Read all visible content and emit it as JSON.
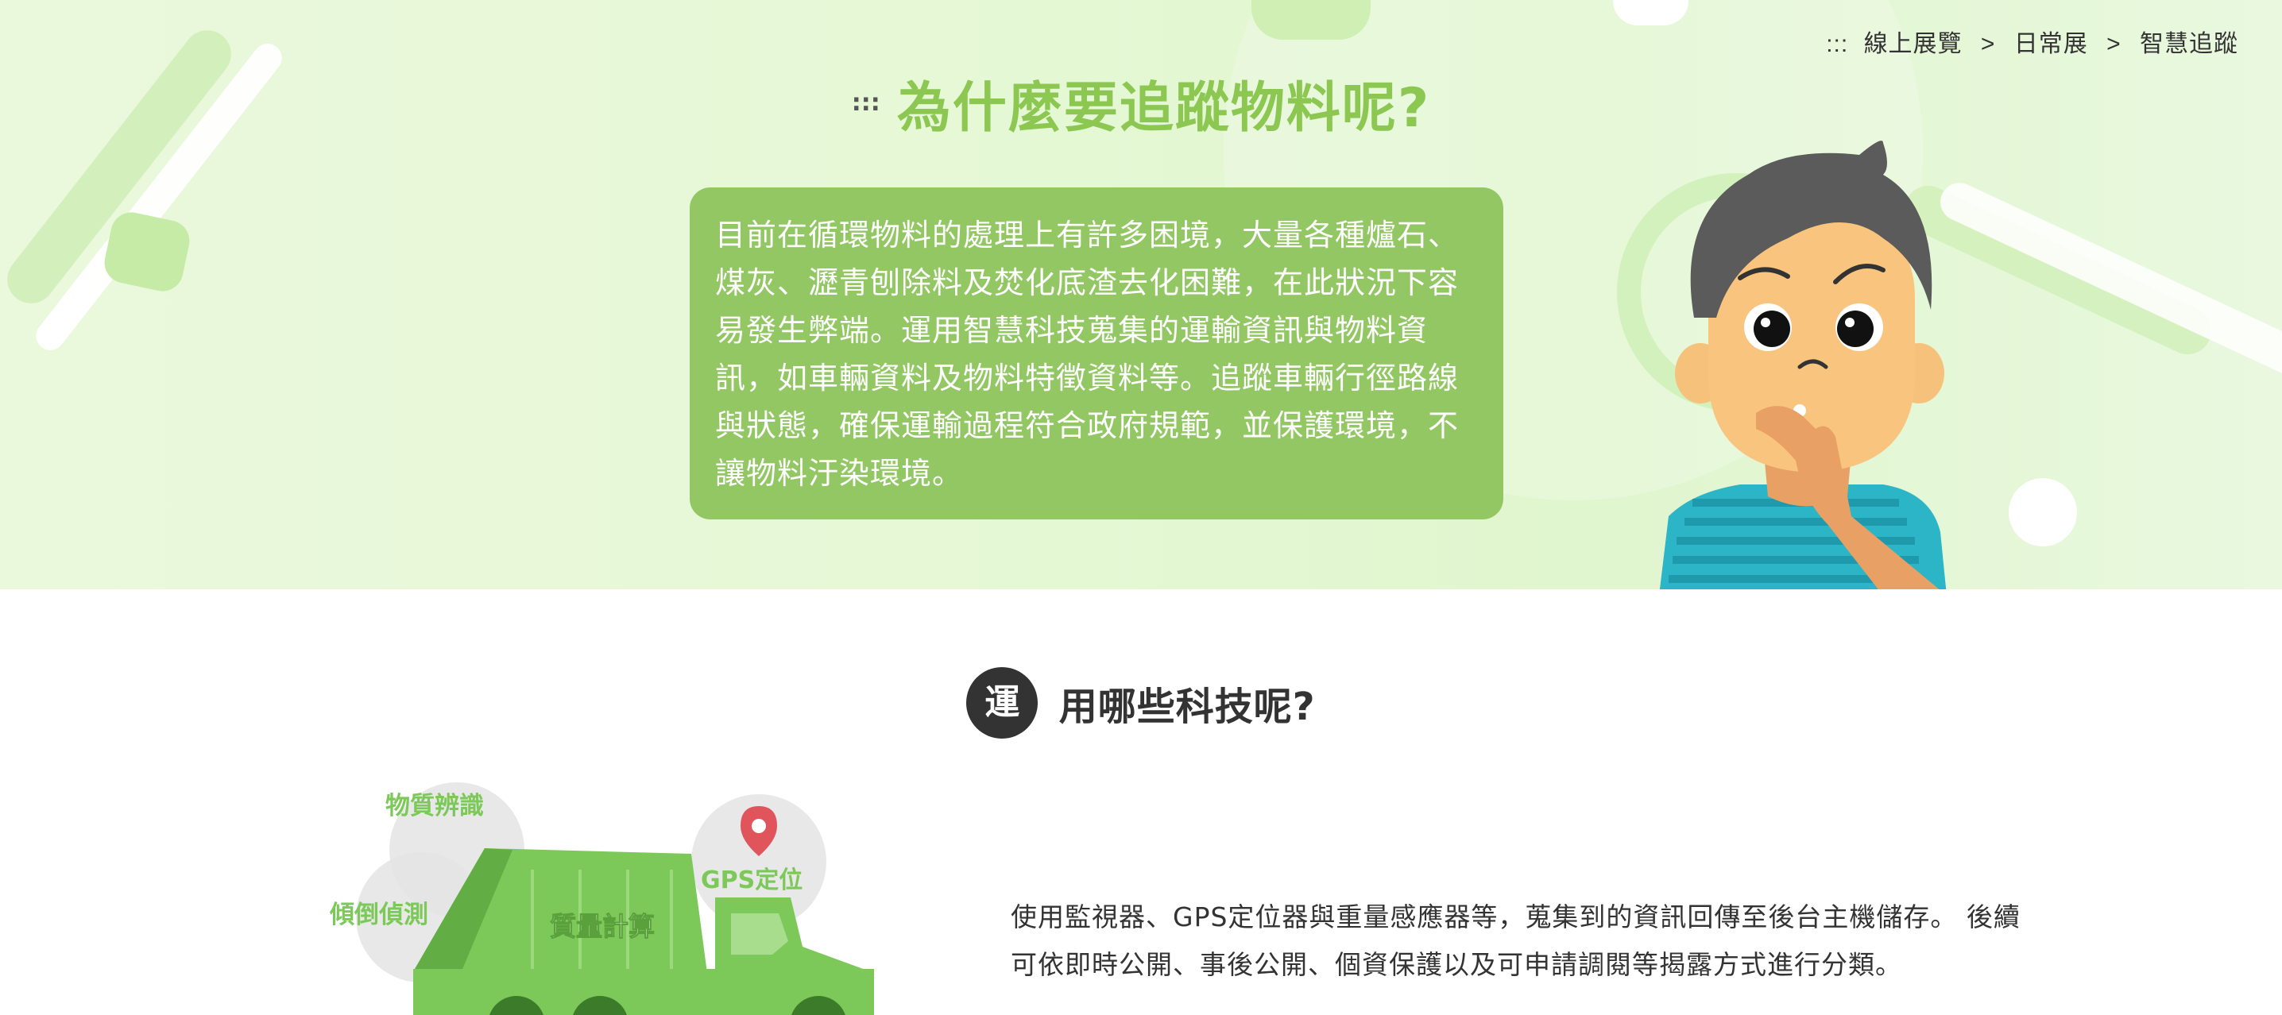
{
  "breadcrumb": {
    "marker": ":::",
    "items": [
      "線上展覽",
      "日常展",
      "智慧追蹤"
    ],
    "separator": ">"
  },
  "hero": {
    "title_marker": ":::",
    "title": "為什麼要追蹤物料呢?",
    "body": "目前在循環物料的處理上有許多困境，大量各種爐石、煤灰、瀝青刨除料及焚化底渣去化困難，在此狀況下容易發生弊端。運用智慧科技蒐集的運輸資訊與物料資訊，如車輛資料及物料特徵資料等。追蹤車輛行徑路線與狀態，確保運輸過程符合政府規範，並保護環境，不讓物料汙染環境。"
  },
  "section": {
    "badge": "運",
    "title": "用哪些科技呢?",
    "description": "使用監視器、GPS定位器與重量感應器等，蒐集到的資訊回傳至後台主機儲存。 後續可依即時公開、事後公開、個資保護以及可申請調閱等揭露方式進行分類。"
  },
  "truck": {
    "labels": {
      "identification": "物質辨識",
      "tilt": "傾倒偵測",
      "weight": "質量計算",
      "gps": "GPS定位"
    }
  },
  "colors": {
    "accent_green": "#8cc752",
    "box_green": "#92c764",
    "truck_green": "#7cc95a",
    "dark": "#333333",
    "pin_red": "#e0545c"
  }
}
